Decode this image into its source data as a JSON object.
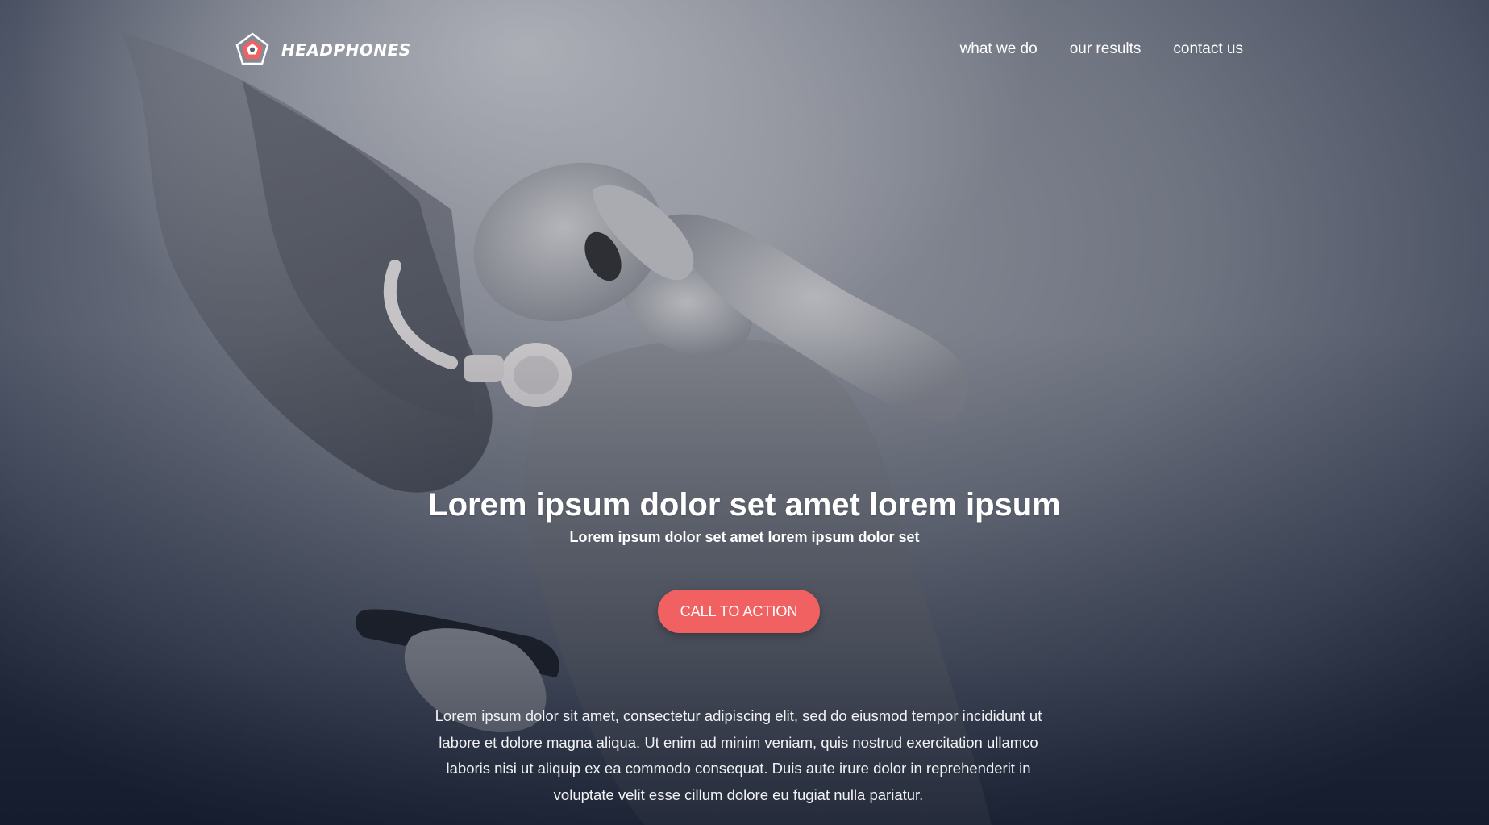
{
  "brand": {
    "name": "HEADPHONES",
    "accent_color": "#f16161",
    "logo_icon": "pentagon-logo-icon"
  },
  "nav": {
    "items": [
      {
        "label": "what we do"
      },
      {
        "label": "our results"
      },
      {
        "label": "contact us"
      }
    ]
  },
  "hero": {
    "headline": "Lorem ipsum dolor set amet lorem ipsum",
    "subheadline": "Lorem ipsum dolor set amet lorem ipsum dolor set",
    "cta_label": "CALL TO ACTION",
    "body": "Lorem ipsum dolor sit amet, consectetur adipiscing elit, sed do eiusmod tempor incididunt ut labore et dolore magna aliqua. Ut enim ad minim veniam, quis nostrud exercitation ullamco laboris nisi ut aliquip ex ea commodo consequat. Duis aute irure dolor in reprehenderit in voluptate velit esse cillum dolore eu fugiat nulla pariatur."
  }
}
